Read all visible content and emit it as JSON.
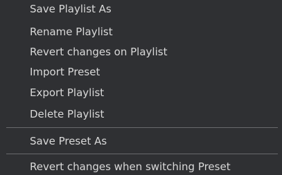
{
  "menu": {
    "playlist_items": [
      {
        "label": "Save Playlist As"
      },
      {
        "label": "Rename Playlist"
      },
      {
        "label": "Revert changes on Playlist"
      },
      {
        "label": "Import Preset"
      },
      {
        "label": "Export Playlist"
      },
      {
        "label": "Delete Playlist"
      }
    ],
    "preset_items": [
      {
        "label": "Save Preset As"
      }
    ],
    "option_items": [
      {
        "label": "Revert changes when switching Preset"
      }
    ]
  },
  "colors": {
    "background": "#2f3033",
    "text": "#d9d9d9",
    "separator": "#6a6b6e"
  }
}
